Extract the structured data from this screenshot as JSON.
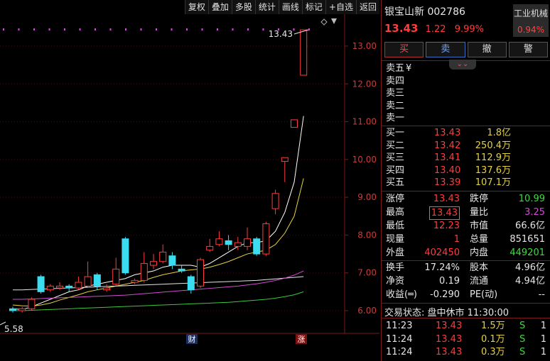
{
  "toolbar": {
    "items": [
      "复权",
      "叠加",
      "多股",
      "统计",
      "画线",
      "标记",
      "+自选",
      "返回"
    ]
  },
  "chart": {
    "y_ticks": [
      "13.00",
      "12.00",
      "11.00",
      "10.00",
      "9.00",
      "8.00",
      "7.00",
      "6.00"
    ],
    "high_label": "13.43",
    "low_label": "5.58",
    "cai_marker": "财",
    "zhang_marker": "涨"
  },
  "chart_data": {
    "type": "candlestick",
    "ylim": [
      5.8,
      13.8
    ],
    "candles": [
      {
        "o": 6.05,
        "c": 6.0,
        "h": 6.1,
        "l": 5.95
      },
      {
        "o": 6.0,
        "c": 6.05,
        "h": 6.1,
        "l": 5.95
      },
      {
        "o": 6.05,
        "c": 6.3,
        "h": 6.35,
        "l": 6.0
      },
      {
        "o": 6.9,
        "c": 6.5,
        "h": 6.95,
        "l": 6.45
      },
      {
        "o": 6.55,
        "c": 6.65,
        "h": 6.7,
        "l": 6.5
      },
      {
        "o": 6.6,
        "c": 6.65,
        "h": 6.75,
        "l": 6.55
      },
      {
        "o": 6.65,
        "c": 6.6,
        "h": 6.7,
        "l": 6.5
      },
      {
        "o": 6.6,
        "c": 6.75,
        "h": 6.9,
        "l": 6.55
      },
      {
        "o": 6.65,
        "c": 6.9,
        "h": 7.3,
        "l": 6.6
      },
      {
        "o": 6.95,
        "c": 6.65,
        "h": 7.0,
        "l": 6.55
      },
      {
        "o": 6.55,
        "c": 6.6,
        "h": 6.7,
        "l": 6.5
      },
      {
        "o": 6.7,
        "c": 7.1,
        "h": 7.4,
        "l": 6.65
      },
      {
        "o": 7.9,
        "c": 7.0,
        "h": 7.95,
        "l": 6.95
      },
      {
        "o": 6.75,
        "c": 6.8,
        "h": 6.85,
        "l": 6.7
      },
      {
        "o": 6.8,
        "c": 7.25,
        "h": 7.55,
        "l": 6.75
      },
      {
        "o": 7.2,
        "c": 7.3,
        "h": 7.5,
        "l": 7.1
      },
      {
        "o": 7.3,
        "c": 7.55,
        "h": 7.75,
        "l": 7.25
      },
      {
        "o": 7.45,
        "c": 7.2,
        "h": 7.55,
        "l": 7.1
      },
      {
        "o": 7.1,
        "c": 7.05,
        "h": 7.2,
        "l": 7.0
      },
      {
        "o": 6.9,
        "c": 6.55,
        "h": 6.95,
        "l": 6.45
      },
      {
        "o": 6.65,
        "c": 7.35,
        "h": 7.4,
        "l": 6.6
      },
      {
        "o": 7.6,
        "c": 7.7,
        "h": 7.9,
        "l": 7.55
      },
      {
        "o": 7.75,
        "c": 7.9,
        "h": 8.1,
        "l": 7.7
      },
      {
        "o": 7.85,
        "c": 7.75,
        "h": 8.0,
        "l": 7.6
      },
      {
        "o": 7.7,
        "c": 7.8,
        "h": 7.95,
        "l": 7.6
      },
      {
        "o": 7.7,
        "c": 7.9,
        "h": 8.2,
        "l": 7.6
      },
      {
        "o": 7.9,
        "c": 7.5,
        "h": 7.95,
        "l": 7.45
      },
      {
        "o": 7.5,
        "c": 8.3,
        "h": 8.35,
        "l": 7.45
      },
      {
        "o": 8.7,
        "c": 9.1,
        "h": 9.2,
        "l": 8.55
      },
      {
        "o": 9.95,
        "c": 10.05,
        "h": 10.05,
        "l": 9.4
      },
      {
        "o": 10.85,
        "c": 11.05,
        "h": 11.05,
        "l": 10.85
      },
      {
        "o": 12.23,
        "c": 13.43,
        "h": 13.43,
        "l": 12.23
      }
    ],
    "ma_lines": [
      {
        "name": "MA5",
        "color": "#ffffff",
        "values": [
          6.05,
          6.03,
          6.1,
          6.2,
          6.3,
          6.4,
          6.5,
          6.55,
          6.65,
          6.7,
          6.75,
          6.8,
          6.85,
          6.95,
          7.0,
          7.05,
          7.15,
          7.2,
          7.2,
          7.2,
          7.15,
          7.25,
          7.4,
          7.55,
          7.7,
          7.8,
          7.8,
          7.85,
          8.1,
          8.6,
          9.4,
          11.15
        ]
      },
      {
        "name": "MA10",
        "color": "#e6d23c",
        "values": [
          6.15,
          6.13,
          6.12,
          6.15,
          6.2,
          6.28,
          6.35,
          6.42,
          6.5,
          6.55,
          6.6,
          6.65,
          6.7,
          6.75,
          6.8,
          6.88,
          6.95,
          7.0,
          7.05,
          7.08,
          7.1,
          7.15,
          7.22,
          7.3,
          7.4,
          7.5,
          7.55,
          7.6,
          7.75,
          8.05,
          8.5,
          9.5
        ]
      },
      {
        "name": "MA20",
        "color": "#e6e6e6",
        "values": [
          6.55,
          6.55,
          6.56,
          6.57,
          6.58,
          6.59,
          6.6,
          6.61,
          6.62,
          6.63,
          6.64,
          6.65,
          6.66,
          6.67,
          6.68,
          6.69,
          6.7,
          6.71,
          6.72,
          6.73,
          6.74,
          6.75,
          6.76,
          6.77,
          6.78,
          6.79,
          6.8,
          6.82,
          6.84,
          6.86,
          6.88,
          6.9
        ]
      },
      {
        "name": "MA30",
        "color": "#d24cd2",
        "values": [
          6.3,
          6.3,
          6.31,
          6.32,
          6.33,
          6.34,
          6.35,
          6.36,
          6.37,
          6.38,
          6.39,
          6.4,
          6.41,
          6.43,
          6.45,
          6.47,
          6.49,
          6.51,
          6.53,
          6.55,
          6.57,
          6.59,
          6.61,
          6.63,
          6.65,
          6.68,
          6.71,
          6.75,
          6.8,
          6.86,
          6.94,
          7.05
        ]
      },
      {
        "name": "MA60",
        "color": "#3cc83c",
        "values": [
          6.0,
          6.0,
          6.01,
          6.02,
          6.03,
          6.04,
          6.05,
          6.06,
          6.07,
          6.08,
          6.09,
          6.1,
          6.11,
          6.12,
          6.13,
          6.14,
          6.15,
          6.16,
          6.17,
          6.18,
          6.19,
          6.2,
          6.21,
          6.22,
          6.24,
          6.26,
          6.28,
          6.3,
          6.33,
          6.37,
          6.42,
          6.5
        ]
      }
    ]
  },
  "header": {
    "stock_name": "银宝山新 002786",
    "price": "13.43",
    "change": "1.22",
    "change_pct": "9.99%",
    "industry_name": "工业机械",
    "industry_pct": "0.94%"
  },
  "trade_buttons": {
    "buy": "买",
    "sell": "卖",
    "cancel": "撤",
    "alert": "警"
  },
  "sell_orders": [
    {
      "label": "卖五",
      "price": "¥",
      "vol": ""
    },
    {
      "label": "卖四",
      "price": "",
      "vol": ""
    },
    {
      "label": "卖三",
      "price": "",
      "vol": ""
    },
    {
      "label": "卖二",
      "price": "",
      "vol": ""
    },
    {
      "label": "卖一",
      "price": "",
      "vol": ""
    }
  ],
  "buy_orders": [
    {
      "label": "买一",
      "price": "13.43",
      "vol": "1.8亿"
    },
    {
      "label": "买二",
      "price": "13.42",
      "vol": "250.4万"
    },
    {
      "label": "买三",
      "price": "13.41",
      "vol": "112.9万"
    },
    {
      "label": "买四",
      "price": "13.40",
      "vol": "137.6万"
    },
    {
      "label": "买五",
      "price": "13.39",
      "vol": "107.1万"
    }
  ],
  "stats": [
    {
      "l1": "涨停",
      "v1": "13.43",
      "l2": "跌停",
      "v2": "10.99"
    },
    {
      "l1": "最高",
      "v1": "13.43",
      "l2": "量比",
      "v2": "3.25"
    },
    {
      "l1": "最低",
      "v1": "12.23",
      "l2": "市值",
      "v2": "66.6亿"
    },
    {
      "l1": "现量",
      "v1": "1",
      "l2": "总量",
      "v2": "851651"
    },
    {
      "l1": "外盘",
      "v1": "402450",
      "l2": "内盘",
      "v2": "449201"
    }
  ],
  "fundamentals": [
    {
      "l1": "换手",
      "v1": "17.24%",
      "l2": "股本",
      "v2": "4.96亿"
    },
    {
      "l1": "净资",
      "v1": "0.19",
      "l2": "流通",
      "v2": "4.94亿"
    },
    {
      "l1": "收益(═)",
      "v1": "-0.290",
      "l2": "PE(动)",
      "v2": "--"
    }
  ],
  "trading_status": "交易状态: 盘中休市 11:30:00",
  "ticks": [
    {
      "time": "11:23",
      "price": "13.43",
      "vol": "1.5万",
      "side": "S",
      "n": "1"
    },
    {
      "time": "11:24",
      "price": "13.43",
      "vol": "0.1万",
      "side": "S",
      "n": "1"
    },
    {
      "time": "11:24",
      "price": "13.43",
      "vol": "0.3万",
      "side": "S",
      "n": "1"
    }
  ],
  "colors": {
    "up": "#ff3c3c",
    "down": "#3cdcf0",
    "separator": "#7a1a1a"
  }
}
